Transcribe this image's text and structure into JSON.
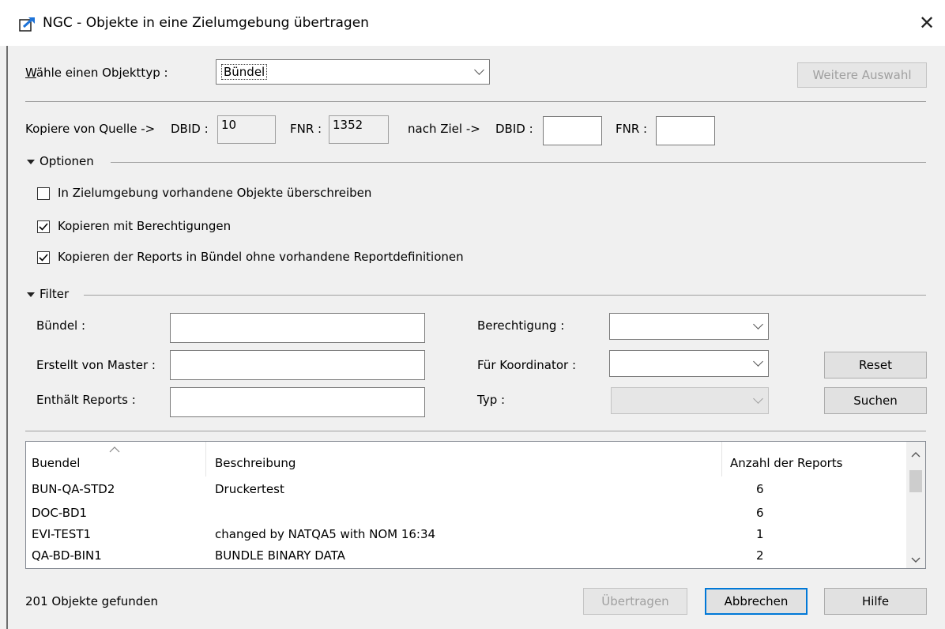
{
  "window": {
    "title": "NGC - Objekte in eine Zielumgebung übertragen",
    "close": "✕"
  },
  "objecttype": {
    "label": "Wähle einen Objekttyp :",
    "value": "Bündel",
    "more_button": "Weitere Auswahl"
  },
  "copy": {
    "source_label": "Kopiere von Quelle ->",
    "dbid_label": "DBID :",
    "dbid_value": "10",
    "fnr_label": "FNR :",
    "fnr_value": "1352",
    "target_label": "nach Ziel ->",
    "target_dbid_label": "DBID :",
    "target_dbid_value": "",
    "target_fnr_label": "FNR :",
    "target_fnr_value": ""
  },
  "options": {
    "title": "Optionen",
    "items": [
      {
        "label": "In Zielumgebung vorhandene Objekte überschreiben",
        "checked": false
      },
      {
        "label": "Kopieren mit Berechtigungen",
        "checked": true
      },
      {
        "label": "Kopieren der Reports in Bündel ohne vorhandene Reportdefinitionen",
        "checked": true
      }
    ]
  },
  "filter": {
    "title": "Filter",
    "buendel_label": "Bündel :",
    "buendel_value": "",
    "master_label": "Erstellt von Master :",
    "master_value": "",
    "reports_label": "Enthält Reports :",
    "reports_value": "",
    "berechtigung_label": "Berechtigung :",
    "berechtigung_value": "",
    "koordinator_label": "Für Koordinator :",
    "koordinator_value": "",
    "typ_label": "Typ :",
    "typ_value": "",
    "reset_button": "Reset",
    "search_button": "Suchen"
  },
  "table": {
    "columns": [
      "Buendel",
      "Beschreibung",
      "Anzahl der Reports"
    ],
    "rows": [
      [
        "BUN-QA-STD2",
        "Druckertest",
        "6"
      ],
      [
        "DOC-BD1",
        "",
        "6"
      ],
      [
        "EVI-TEST1",
        "changed by NATQA5 with NOM 16:34",
        "1"
      ],
      [
        "QA-BD-BIN1",
        "BUNDLE BINARY DATA",
        "2"
      ]
    ]
  },
  "footer": {
    "status": "201 Objekte gefunden",
    "transfer_button": "Übertragen",
    "cancel_button": "Abbrechen",
    "help_button": "Hilfe"
  }
}
